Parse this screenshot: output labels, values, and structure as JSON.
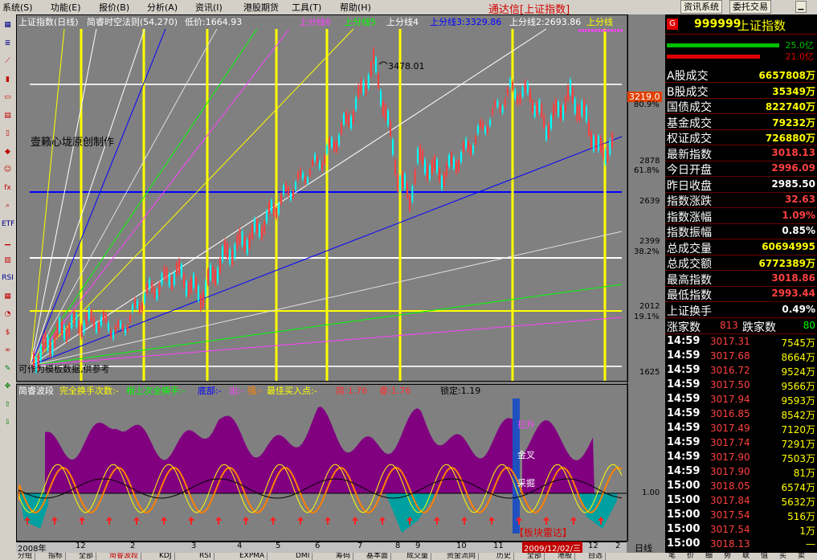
{
  "menubar": {
    "items": [
      "系统(S)",
      "功能(E)",
      "报价(B)",
      "分析(A)",
      "资讯(I)",
      "港股期货",
      "工具(T)",
      "帮助(H)"
    ],
    "title": "通达信[上证指数]",
    "buttons": [
      "资讯系统",
      "委托交易"
    ]
  },
  "toolbar": {
    "icons": [
      "grid-icon",
      "list-icon",
      "line-chart-icon",
      "candle-icon",
      "window-icon",
      "table-icon",
      "page-icon",
      "gift-icon",
      "people-icon",
      "fx-icon",
      "search-icon",
      "ETF",
      "vol-icon",
      "chart-icon",
      "RSI",
      "bar-icon",
      "pie-icon",
      "dollar-icon",
      "link-icon",
      "pencil-icon",
      "move-icon",
      "up-icon",
      "down-icon"
    ]
  },
  "chart": {
    "header": {
      "name": "上证指数(日线)",
      "method": "简睿时空法则(54,270)",
      "low": "低价:1664.93",
      "lines": [
        "上分线6",
        "上分线5",
        "上分线4",
        "上分线3:3329.86",
        "上分线2:2693.86",
        "上分线"
      ],
      "line_colors": [
        "#ff40ff",
        "#00ff00",
        "#ffffff",
        "#0000ff",
        "#ffffff",
        "#ffff00"
      ]
    },
    "peak_label": "3478.01",
    "watermark": "壹籁心垅原创制作",
    "footnote": "可作为模板数据,供参考",
    "y_axis_labels": [
      "3219.0",
      "80.9%",
      "2878",
      "61.8%",
      "2639",
      "2399",
      "38.2%",
      "2012",
      "19.1%",
      "1625",
      "1.00"
    ],
    "current_price_tag": "3219.0",
    "indicator_header": {
      "name": "简睿波段",
      "items": [
        "完全换手次数:-",
        "相上次全换手:-",
        "底部:-",
        "出:-",
        "强:-",
        "最佳买入点:-",
        "简:1.76",
        "睿:1.76",
        "锁定:1.19"
      ]
    },
    "indicator_labels": [
      "拉升",
      "金叉",
      "采掘",
      "【板块雷达】"
    ],
    "x_axis": [
      "2008年",
      "12",
      "2",
      "3",
      "4",
      "5",
      "6",
      "7",
      "8",
      "9",
      "10",
      "11",
      "2009/12/02/三",
      "12",
      "2"
    ],
    "period": "日线",
    "bottom_tabs": [
      "分组",
      "指标",
      "全部",
      "简睿波段",
      "KDJ",
      "RSI",
      "EXPMA",
      "DMI",
      "筹码",
      "基本面",
      "成交量",
      "资金流向",
      "历史",
      "全部",
      "港股",
      "自选"
    ]
  },
  "right_panel": {
    "code": "999999",
    "name": "上证指数",
    "bars": [
      {
        "value": "25.0亿",
        "color": "#00c000",
        "fraction": 0.7
      },
      {
        "value": "21.0亿",
        "color": "#e00000",
        "fraction": 0.58
      }
    ],
    "stats": [
      {
        "label": "Α股成交",
        "value": "6657808万",
        "color": "#ffff00"
      },
      {
        "label": "Β股成交",
        "value": "35349万",
        "color": "#ffff00"
      },
      {
        "label": "国债成交",
        "value": "822740万",
        "color": "#ffff00"
      },
      {
        "label": "基金成交",
        "value": "79232万",
        "color": "#ffff00"
      },
      {
        "label": "权证成交",
        "value": "726880万",
        "color": "#ffff00"
      },
      {
        "label": "最新指数",
        "value": "3018.13",
        "color": "#ff4040"
      },
      {
        "label": "今日开盘",
        "value": "2996.09",
        "color": "#ff4040"
      },
      {
        "label": "昨日收盘",
        "value": "2985.50",
        "color": "#ffffff"
      },
      {
        "label": "指数涨跌",
        "value": "32.63",
        "color": "#ff4040"
      },
      {
        "label": "指数涨幅",
        "value": "1.09%",
        "color": "#ff4040"
      },
      {
        "label": "指数振幅",
        "value": "0.85%",
        "color": "#ffffff"
      },
      {
        "label": "总成交量",
        "value": "60694995",
        "color": "#ffff00"
      },
      {
        "label": "总成交额",
        "value": "6772389万",
        "color": "#ffff00"
      },
      {
        "label": "最高指数",
        "value": "3018.86",
        "color": "#ff4040"
      },
      {
        "label": "最低指数",
        "value": "2993.44",
        "color": "#ff4040"
      },
      {
        "label": "上证换手",
        "value": "0.49%",
        "color": "#ffffff"
      }
    ],
    "updown": {
      "up_label": "涨家数",
      "up_value": "813",
      "down_label": "跌家数",
      "down_value": "80"
    },
    "ticks": [
      {
        "time": "14:59",
        "price": "3017.31",
        "vol": "7545万"
      },
      {
        "time": "14:59",
        "price": "3017.68",
        "vol": "8664万"
      },
      {
        "time": "14:59",
        "price": "3016.72",
        "vol": "9524万"
      },
      {
        "time": "14:59",
        "price": "3017.50",
        "vol": "9566万"
      },
      {
        "time": "14:59",
        "price": "3017.94",
        "vol": "9593万"
      },
      {
        "time": "14:59",
        "price": "3016.85",
        "vol": "8542万"
      },
      {
        "time": "14:59",
        "price": "3017.49",
        "vol": "7120万"
      },
      {
        "time": "14:59",
        "price": "3017.74",
        "vol": "7291万"
      },
      {
        "time": "14:59",
        "price": "3017.90",
        "vol": "7503万"
      },
      {
        "time": "14:59",
        "price": "3017.90",
        "vol": "81万"
      },
      {
        "time": "15:00",
        "price": "3018.05",
        "vol": "6574万"
      },
      {
        "time": "15:00",
        "price": "3017.84",
        "vol": "5632万"
      },
      {
        "time": "15:00",
        "price": "3017.54",
        "vol": "516万"
      },
      {
        "time": "15:00",
        "price": "3017.54",
        "vol": "1万"
      },
      {
        "time": "15:00",
        "price": "3018.13",
        "vol": "—"
      }
    ],
    "bottom_tabs": [
      "笔",
      "价",
      "细",
      "势",
      "联",
      "值",
      "买",
      "卖"
    ]
  }
}
